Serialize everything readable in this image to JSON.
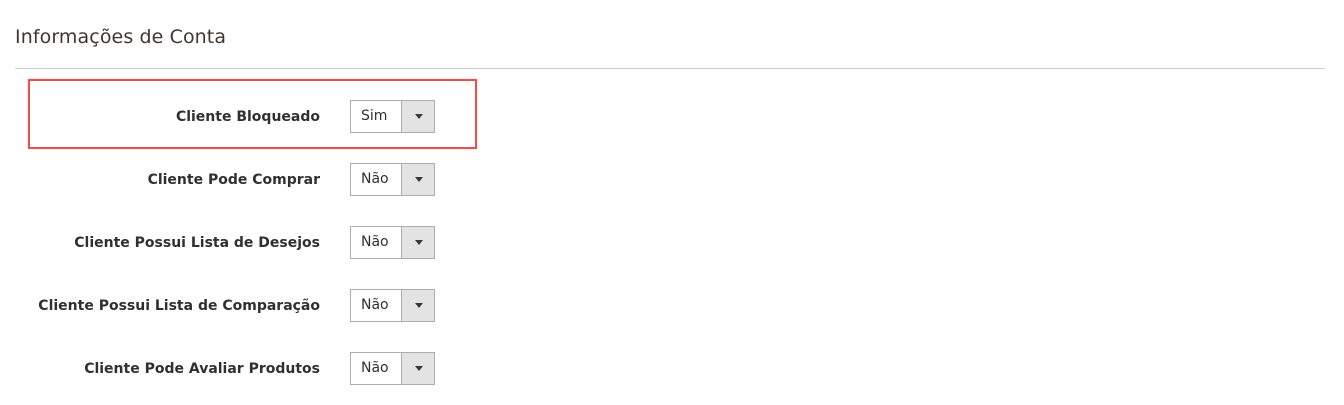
{
  "section": {
    "title": "Informações de Conta"
  },
  "fields": [
    {
      "label": "Cliente Bloqueado",
      "value": "Sim"
    },
    {
      "label": "Cliente Pode Comprar",
      "value": "Não"
    },
    {
      "label": "Cliente Possui Lista de Desejos",
      "value": "Não"
    },
    {
      "label": "Cliente Possui Lista de Comparação",
      "value": "Não"
    },
    {
      "label": "Cliente Pode Avaliar Produtos",
      "value": "Não"
    }
  ],
  "colors": {
    "highlight": "#e0564f",
    "divider": "#cccccc",
    "select_arrow_bg": "#e3e3e3"
  },
  "icons": {
    "select_arrow": "caret-down-icon"
  }
}
